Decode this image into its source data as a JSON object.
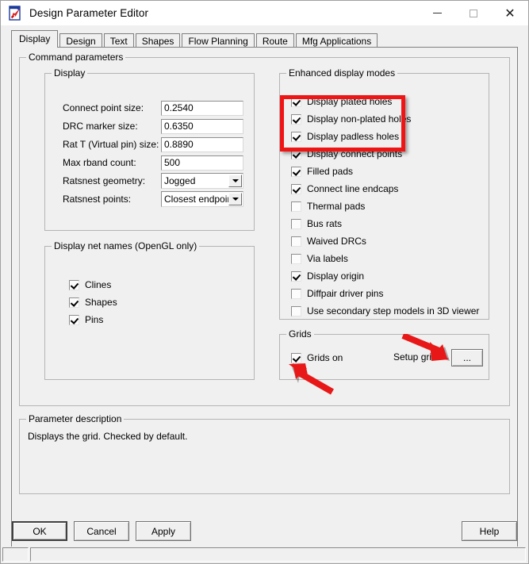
{
  "window": {
    "title": "Design Parameter Editor",
    "icon": "app-document-rocket-icon",
    "minimize_label": "Minimize",
    "maximize_label": "Maximize",
    "close_label": "Close"
  },
  "tabs": [
    {
      "label": "Display",
      "active": true
    },
    {
      "label": "Design",
      "active": false
    },
    {
      "label": "Text",
      "active": false
    },
    {
      "label": "Shapes",
      "active": false
    },
    {
      "label": "Flow Planning",
      "active": false
    },
    {
      "label": "Route",
      "active": false
    },
    {
      "label": "Mfg Applications",
      "active": false
    }
  ],
  "command_parameters": {
    "legend": "Command parameters",
    "display_group": {
      "legend": "Display",
      "fields": [
        {
          "label": "Connect point size:",
          "value": "0.2540",
          "type": "text"
        },
        {
          "label": "DRC marker size:",
          "value": "0.6350",
          "type": "text"
        },
        {
          "label": "Rat T (Virtual pin) size:",
          "value": "0.8890",
          "type": "text"
        },
        {
          "label": "Max rband count:",
          "value": "500",
          "type": "text"
        },
        {
          "label": "Ratsnest geometry:",
          "value": "Jogged",
          "type": "combo"
        },
        {
          "label": "Ratsnest points:",
          "value": "Closest endpoint",
          "type": "combo"
        }
      ]
    },
    "net_names_group": {
      "legend": "Display net names (OpenGL only)",
      "items": [
        {
          "label": "Clines",
          "checked": true
        },
        {
          "label": "Shapes",
          "checked": true
        },
        {
          "label": "Pins",
          "checked": true
        }
      ]
    },
    "enhanced_group": {
      "legend": "Enhanced display modes",
      "items": [
        {
          "label": "Display plated holes",
          "checked": true,
          "highlighted": true
        },
        {
          "label": "Display non-plated holes",
          "checked": true,
          "highlighted": true
        },
        {
          "label": "Display padless holes",
          "checked": true,
          "highlighted": true
        },
        {
          "label": "Display connect points",
          "checked": true,
          "highlighted": false
        },
        {
          "label": "Filled pads",
          "checked": true,
          "highlighted": false
        },
        {
          "label": "Connect line endcaps",
          "checked": true,
          "highlighted": false
        },
        {
          "label": "Thermal pads",
          "checked": false,
          "highlighted": false
        },
        {
          "label": "Bus rats",
          "checked": false,
          "highlighted": false
        },
        {
          "label": "Waived DRCs",
          "checked": false,
          "highlighted": false
        },
        {
          "label": "Via labels",
          "checked": false,
          "highlighted": false
        },
        {
          "label": "Display origin",
          "checked": true,
          "highlighted": false
        },
        {
          "label": "Diffpair driver pins",
          "checked": false,
          "highlighted": false
        },
        {
          "label": "Use secondary step models in 3D viewer",
          "checked": false,
          "highlighted": false
        }
      ]
    },
    "grids_group": {
      "legend": "Grids",
      "grids_on": {
        "label": "Grids on",
        "checked": true
      },
      "setup_grids_label": "Setup grids",
      "setup_grids_button": "..."
    }
  },
  "parameter_description": {
    "legend": "Parameter description",
    "text": "Displays the grid. Checked by default."
  },
  "buttons": {
    "ok": "OK",
    "cancel": "Cancel",
    "apply": "Apply",
    "help": "Help"
  },
  "annotations": {
    "highlight_color": "#f01414",
    "rectangle_target": "enhanced-display-modes-first-three-holes-options",
    "arrows": [
      {
        "name": "arrow-to-setup-grids-button",
        "points_to": "setup-grids-dots-button"
      },
      {
        "name": "arrow-to-grids-on-checkbox",
        "points_to": "grids-on-checkbox"
      }
    ]
  }
}
